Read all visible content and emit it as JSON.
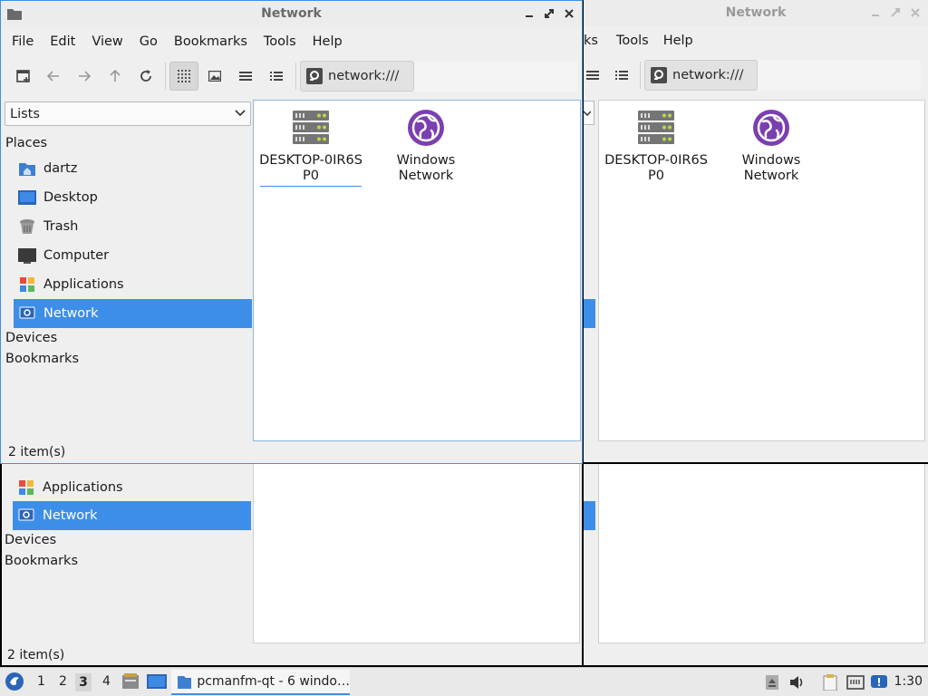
{
  "window_title": "Network",
  "menu": [
    "File",
    "Edit",
    "View",
    "Go",
    "Bookmarks",
    "Tools",
    "Help"
  ],
  "menu_right_visible": [
    "ks",
    "Tools",
    "Help"
  ],
  "address": "network:///",
  "side_combo": "Lists",
  "sidebar": {
    "places_label": "Places",
    "items": [
      {
        "label": "dartz",
        "icon": "home-folder-icon"
      },
      {
        "label": "Desktop",
        "icon": "desktop-icon"
      },
      {
        "label": "Trash",
        "icon": "trash-icon"
      },
      {
        "label": "Computer",
        "icon": "computer-icon"
      },
      {
        "label": "Applications",
        "icon": "applications-icon"
      },
      {
        "label": "Network",
        "icon": "network-icon"
      }
    ],
    "devices_label": "Devices",
    "bookmarks_label": "Bookmarks"
  },
  "files": [
    {
      "name": "DESKTOP-0IR6S\nP0",
      "line1": "DESKTOP-0IR6S",
      "line2": "P0",
      "icon": "server-icon"
    },
    {
      "name": "Windows Network",
      "line1": "Windows",
      "line2": "Network",
      "icon": "globe-icon"
    }
  ],
  "status": "2 item(s)",
  "panel": {
    "desktops": [
      "1",
      "2",
      "3",
      "4"
    ],
    "active_desktop": "3",
    "task_label": "pcmanfm-qt - 6 windo…",
    "clock": "1:30"
  },
  "colors": {
    "selection": "#3d8ee8",
    "accent_purple": "#7b3fb0"
  }
}
